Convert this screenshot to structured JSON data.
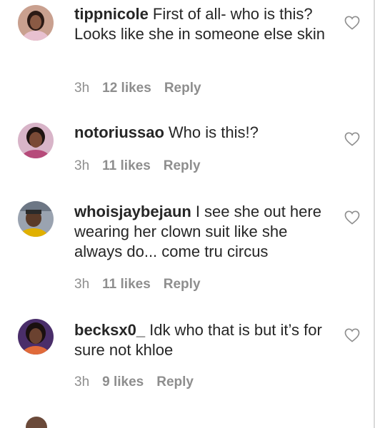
{
  "comments": [
    {
      "username": "tippnicole",
      "text": "First of all- who is this? Looks like she in someone else skin",
      "time": "3h",
      "likes": "12 likes",
      "reply": "Reply",
      "avatar_colors": {
        "bg": "#c9a08f",
        "skin": "#8a5a44",
        "hair": "#2b1a15",
        "shirt": "#e8c1d0"
      }
    },
    {
      "username": "notoriussao",
      "text": "Who is this!?",
      "time": "3h",
      "likes": "11 likes",
      "reply": "Reply",
      "avatar_colors": {
        "bg": "#d8b4c8",
        "skin": "#7a4a36",
        "hair": "#1f1412",
        "shirt": "#b64a7a"
      }
    },
    {
      "username": "whoisjaybejaun",
      "text": "I see she out here wearing her clown suit like she always do... come tru circus",
      "time": "3h",
      "likes": "11 likes",
      "reply": "Reply",
      "avatar_colors": {
        "bg": "#9aa3b0",
        "skin": "#5a3a28",
        "hair": "#2a2a2a",
        "shirt": "#e0b000"
      }
    },
    {
      "username": "becksx0_",
      "text": "Idk who that is but it’s for sure not khloe",
      "time": "3h",
      "likes": "9 likes",
      "reply": "Reply",
      "avatar_colors": {
        "bg": "#4a2e6a",
        "skin": "#6b4230",
        "hair": "#1a1010",
        "shirt": "#e06a3a"
      }
    }
  ],
  "icons": {
    "like": "heart-outline-icon"
  }
}
